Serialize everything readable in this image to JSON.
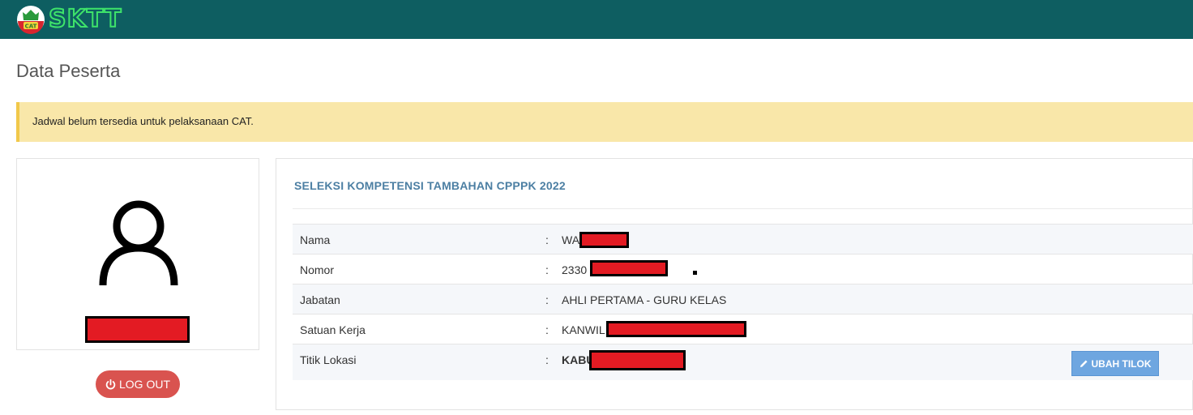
{
  "header": {
    "logo_badge": "CAT",
    "logo_text": "SKTT",
    "colors": {
      "bar": "#0e5e61",
      "logo_outline": "#3ee36a"
    }
  },
  "page": {
    "title": "Data Peserta"
  },
  "alert": {
    "message": "Jadwal belum tersedia untuk pelaksanaan CAT."
  },
  "profile": {
    "avatar_icon": "user-icon",
    "logout_icon": "power-icon",
    "logout_label": "LOG OUT"
  },
  "details": {
    "section_title": "SELEKSI KOMPETENSI TAMBAHAN CPPPK 2022",
    "separator": ":",
    "rows": [
      {
        "label": "Nama",
        "value": "WA"
      },
      {
        "label": "Nomor",
        "value": "2330"
      },
      {
        "label": "Jabatan",
        "value": "AHLI PERTAMA - GURU KELAS"
      },
      {
        "label": "Satuan Kerja",
        "value": "KANWIL"
      },
      {
        "label": "Titik Lokasi",
        "value": "KABU"
      }
    ],
    "ubah_icon": "pencil-icon",
    "ubah_label": "UBAH TILOK"
  }
}
